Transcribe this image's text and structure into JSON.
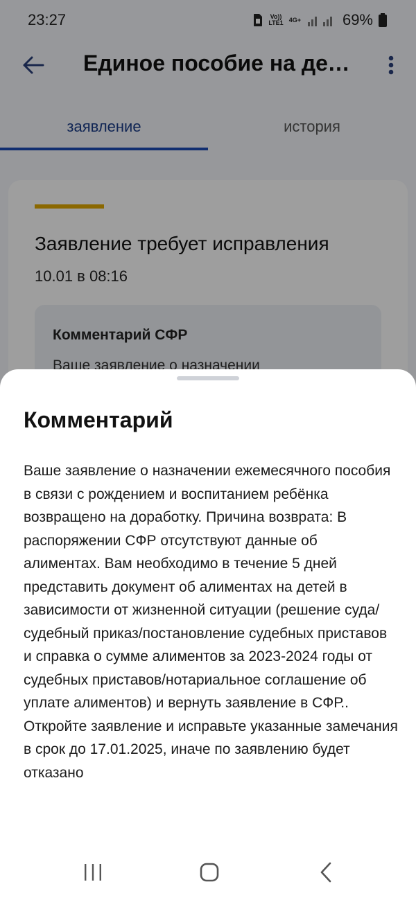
{
  "status_bar": {
    "time": "23:27",
    "network_top": "Vo))",
    "network_bottom": "LTE1",
    "network_type": "4G+",
    "battery": "69%"
  },
  "header": {
    "title": "Единое пособие на детей",
    "back_icon": "arrow-left-icon",
    "menu_icon": "more-vertical-icon"
  },
  "tabs": [
    {
      "label": "заявление",
      "active": true
    },
    {
      "label": "история",
      "active": false
    }
  ],
  "card": {
    "title": "Заявление требует исправления",
    "date": "10.01 в 08:16",
    "comment_label": "Комментарий СФР",
    "comment_preview": "Ваше заявление о назначении",
    "accent_color": "#e0a800"
  },
  "sheet": {
    "title": "Комментарий",
    "body": "Ваше заявление о назначении ежемесячного пособия в связи с рождением и воспитанием ребёнка возвращено на доработку. Причина возврата: В распоряжении СФР отсутствуют данные об алиментах. Вам необходимо в течение 5 дней представить документ об алиментах на детей в зависимости от жизненной ситуации (решение суда/судебный приказ/постановление судебных приставов и справка о сумме алиментов за 2023-2024 годы от судебных приставов/нотариальное соглашение об уплате алиментов) и вернуть заявление в СФР.. Откройте заявление и исправьте указанные замечания в срок до 17.01.2025, иначе по заявлению будет отказано"
  },
  "nav": {
    "recent_icon": "recent-apps-icon",
    "home_icon": "home-icon",
    "back_icon": "back-chevron-icon"
  },
  "colors": {
    "primary": "#1c4bb5",
    "accent": "#e0a800"
  }
}
